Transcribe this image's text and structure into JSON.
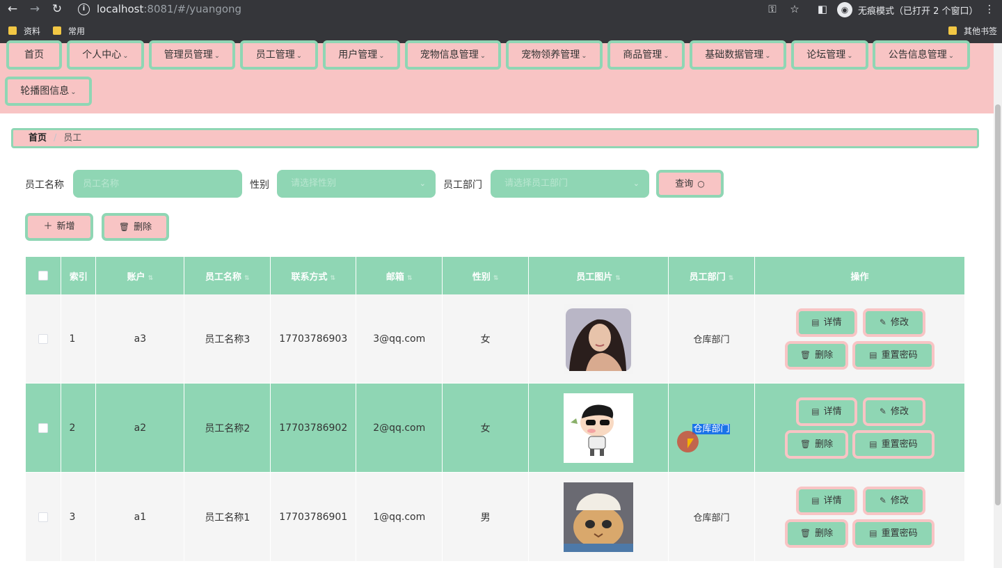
{
  "browser": {
    "url_host": "localhost",
    "url_rest": ":8081/#/yuangong",
    "incognito_text": "无痕模式（已打开 2 个窗口）",
    "bookmarks": [
      "资料",
      "常用"
    ],
    "other_bookmarks": "其他书签"
  },
  "nav": {
    "items": [
      {
        "label": "首页",
        "caret": ""
      },
      {
        "label": "个人中心",
        "caret": "⌄"
      },
      {
        "label": "管理员管理",
        "caret": "⌄"
      },
      {
        "label": "员工管理",
        "caret": "⌄"
      },
      {
        "label": "用户管理",
        "caret": "⌄"
      },
      {
        "label": "宠物信息管理",
        "caret": "⌄"
      },
      {
        "label": "宠物领养管理",
        "caret": "⌄"
      },
      {
        "label": "商品管理",
        "caret": "⌄"
      },
      {
        "label": "基础数据管理",
        "caret": "⌄"
      },
      {
        "label": "论坛管理",
        "caret": "⌄"
      },
      {
        "label": "公告信息管理",
        "caret": "⌄"
      },
      {
        "label": "轮播图信息",
        "caret": "⌄"
      }
    ]
  },
  "breadcrumb": {
    "home": "首页",
    "separator": "/",
    "current": "员工"
  },
  "search": {
    "name_label": "员工名称",
    "name_placeholder": "员工名称",
    "gender_label": "性别",
    "gender_placeholder": "请选择性别",
    "dept_label": "员工部门",
    "dept_placeholder": "请选择员工部门",
    "query_button": "查询"
  },
  "actions": {
    "add": "新增",
    "delete": "删除"
  },
  "table": {
    "headers": {
      "index": "索引",
      "account": "账户",
      "name": "员工名称",
      "phone": "联系方式",
      "email": "邮箱",
      "gender": "性别",
      "photo": "员工图片",
      "dept": "员工部门",
      "ops": "操作"
    },
    "rows": [
      {
        "index": "1",
        "account": "a3",
        "name": "员工名称3",
        "phone": "17703786903",
        "email": "3@qq.com",
        "gender": "女",
        "dept": "仓库部门",
        "photo": "woman-portrait"
      },
      {
        "index": "2",
        "account": "a2",
        "name": "员工名称2",
        "phone": "17703786902",
        "email": "2@qq.com",
        "gender": "女",
        "dept": "仓库部门",
        "photo": "cartoon-boy"
      },
      {
        "index": "3",
        "account": "a1",
        "name": "员工名称1",
        "phone": "17703786901",
        "email": "1@qq.com",
        "gender": "男",
        "dept": "仓库部门",
        "photo": "cat"
      }
    ],
    "row_buttons": {
      "detail": "详情",
      "edit": "修改",
      "delete": "删除",
      "reset": "重置密码"
    }
  },
  "colors": {
    "accent_green": "#8fd6b4",
    "pink": "#f8c4c4",
    "selection_blue": "#1a73e8"
  }
}
